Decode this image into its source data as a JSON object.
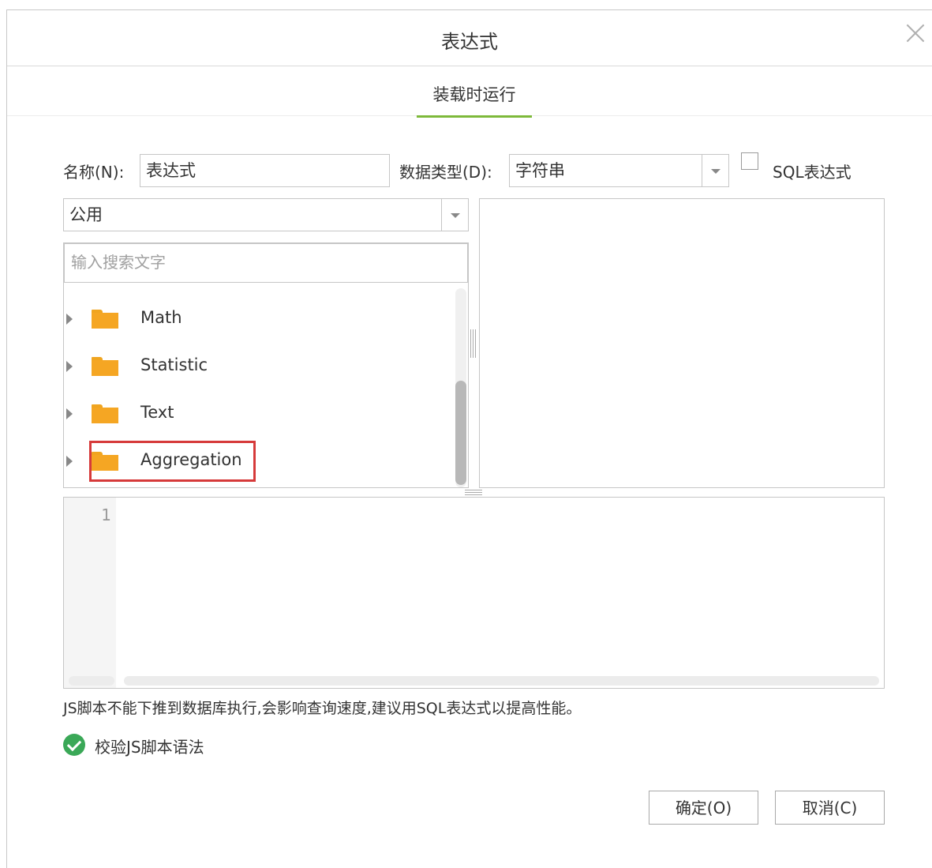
{
  "dialog": {
    "title": "表达式"
  },
  "tabs": [
    {
      "label": "装载时运行",
      "active": true
    }
  ],
  "form": {
    "name_label": "名称(N):",
    "name_value": "表达式",
    "datatype_label": "数据类型(D):",
    "datatype_value": "字符串",
    "sql_checkbox_label": "SQL表达式",
    "sql_checkbox_checked": false
  },
  "function_panel": {
    "category_value": "公用",
    "search_placeholder": "输入搜索文字",
    "items": [
      {
        "label": "Math",
        "icon": "folder-icon"
      },
      {
        "label": "Statistic",
        "icon": "folder-icon"
      },
      {
        "label": "Text",
        "icon": "folder-icon"
      },
      {
        "label": "Aggregation",
        "icon": "folder-icon",
        "highlighted": true
      }
    ]
  },
  "editor": {
    "line_numbers": [
      "1"
    ],
    "content": ""
  },
  "note": "JS脚本不能下推到数据库执行,会影响查询速度,建议用SQL表达式以提高性能。",
  "validate_label": "校验JS脚本语法",
  "buttons": {
    "ok": "确定(O)",
    "cancel": "取消(C)"
  },
  "colors": {
    "tab_underline": "#7db93a",
    "folder": "#f5a623",
    "highlight": "#d63a3a",
    "check": "#3aa857"
  }
}
